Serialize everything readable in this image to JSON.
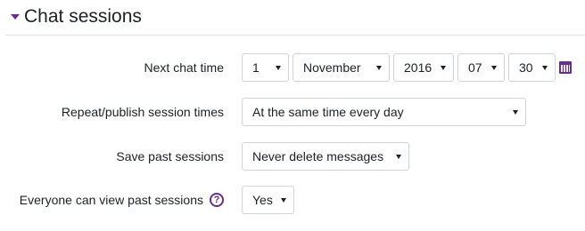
{
  "section": {
    "title": "Chat sessions",
    "collapse_icon": "caret-down-icon"
  },
  "colors": {
    "accent": "#6a2c8f",
    "border": "#ced4da",
    "text": "#1d2125"
  },
  "fields": {
    "next_chat_time": {
      "label": "Next chat time",
      "day": "1",
      "month": "November",
      "year": "2016",
      "hour": "07",
      "minute": "30",
      "calendar_icon": "calendar-icon"
    },
    "repeat_sessions": {
      "label": "Repeat/publish session times",
      "value": "At the same time every day"
    },
    "save_past_sessions": {
      "label": "Save past sessions",
      "value": "Never delete messages"
    },
    "view_past_sessions": {
      "label": "Everyone can view past sessions",
      "help_icon": "question-circle-icon",
      "help_glyph": "?",
      "value": "Yes"
    }
  }
}
